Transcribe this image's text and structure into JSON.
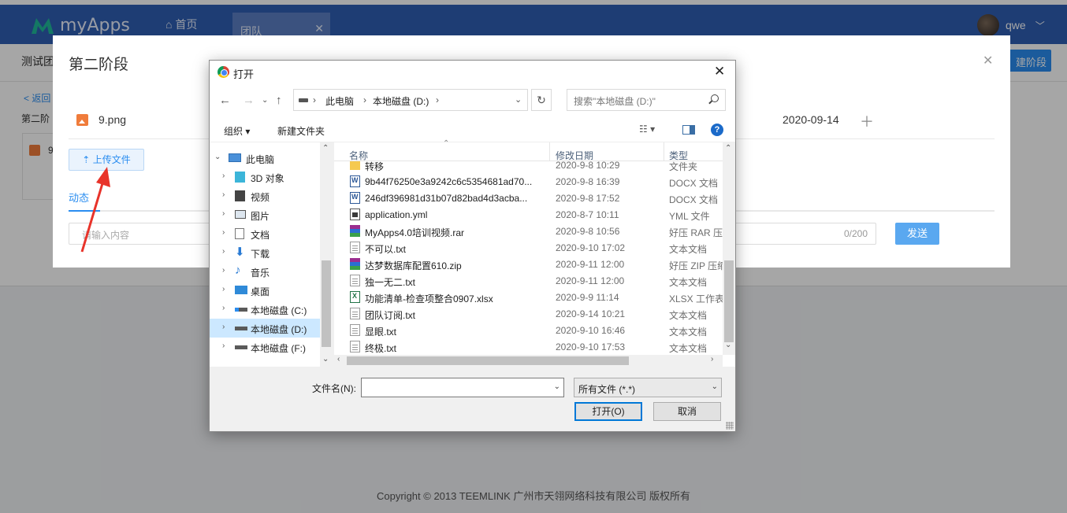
{
  "app": {
    "brand": "myApps",
    "nav_home": "首页",
    "nav_tab": "团队",
    "user_name": "qwe",
    "subheader_title": "测试团",
    "add_stage": "建阶段",
    "back": "< 返回",
    "stage_label": "第二阶",
    "card_label": "9",
    "footer": "Copyright © 2013 TEEMLINK 广州市天翎网络科技有限公司 版权所有"
  },
  "modal": {
    "title": "第二阶段",
    "file_name": "9.png",
    "file_date": "2020-09-14",
    "upload_label": "上传文件",
    "tab_label": "动态",
    "comment_placeholder": "请输入内容",
    "comment_count": "0/200",
    "send_label": "发送"
  },
  "dialog": {
    "title": "打开",
    "breadcrumb": [
      "此电脑",
      "本地磁盘 (D:)"
    ],
    "search_placeholder": "搜索\"本地磁盘 (D:)\"",
    "toolbar": {
      "organize": "组织 ▾",
      "new_folder": "新建文件夹"
    },
    "tree": [
      {
        "label": "此电脑",
        "expanded": true
      },
      {
        "label": "3D 对象"
      },
      {
        "label": "视频"
      },
      {
        "label": "图片"
      },
      {
        "label": "文档"
      },
      {
        "label": "下载"
      },
      {
        "label": "音乐"
      },
      {
        "label": "桌面"
      },
      {
        "label": "本地磁盘 (C:)"
      },
      {
        "label": "本地磁盘 (D:)",
        "selected": true
      },
      {
        "label": "本地磁盘 (F:)"
      }
    ],
    "columns": {
      "name": "名称",
      "date": "修改日期",
      "type": "类型"
    },
    "files": [
      {
        "name": "转移",
        "date": "2020-9-8 10:29",
        "type": "文件夹",
        "icon": "folder"
      },
      {
        "name": "9b44f76250e3a9242c6c5354681ad70...",
        "date": "2020-9-8 16:39",
        "type": "DOCX 文档",
        "icon": "docx"
      },
      {
        "name": "246df396981d31b07d82bad4d3acba...",
        "date": "2020-9-8 17:52",
        "type": "DOCX 文档",
        "icon": "docx"
      },
      {
        "name": "application.yml",
        "date": "2020-8-7 10:11",
        "type": "YML 文件",
        "icon": "yml"
      },
      {
        "name": "MyApps4.0培训视频.rar",
        "date": "2020-9-8 10:56",
        "type": "好压 RAR 压",
        "icon": "rar"
      },
      {
        "name": "不可以.txt",
        "date": "2020-9-10 17:02",
        "type": "文本文档",
        "icon": "txt"
      },
      {
        "name": "达梦数据库配置610.zip",
        "date": "2020-9-11 12:00",
        "type": "好压 ZIP 压缩",
        "icon": "zip"
      },
      {
        "name": "独一无二.txt",
        "date": "2020-9-11 12:00",
        "type": "文本文档",
        "icon": "txt"
      },
      {
        "name": "功能清单-检查项整合0907.xlsx",
        "date": "2020-9-9 11:14",
        "type": "XLSX 工作表",
        "icon": "xlsx"
      },
      {
        "name": "团队订阅.txt",
        "date": "2020-9-14 10:21",
        "type": "文本文档",
        "icon": "txt"
      },
      {
        "name": "显眼.txt",
        "date": "2020-9-10 16:46",
        "type": "文本文档",
        "icon": "txt"
      },
      {
        "name": "终极.txt",
        "date": "2020-9-10 17:53",
        "type": "文本文档",
        "icon": "txt"
      }
    ],
    "filename_label": "文件名(N):",
    "filename_value": "",
    "filetype": "所有文件 (*.*)",
    "open_label": "打开(O)",
    "cancel_label": "取消"
  },
  "colors": {
    "topbar": "#2f5fb3",
    "accent": "#2a8df0",
    "selected": "#cce8ff"
  }
}
